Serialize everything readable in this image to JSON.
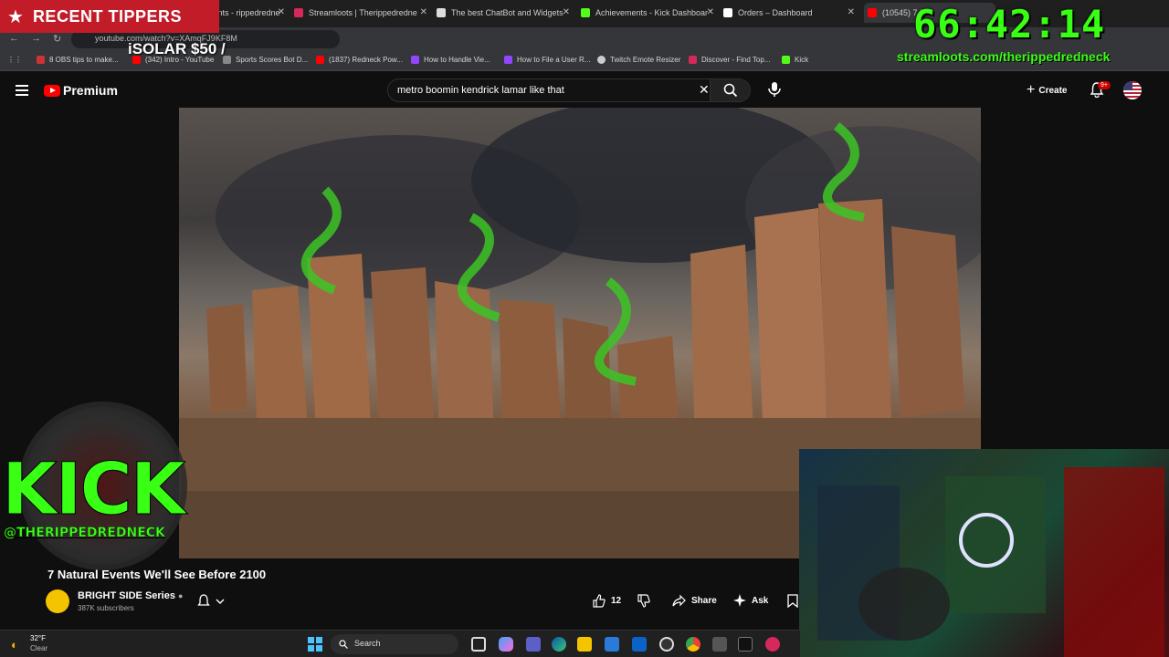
{
  "overlay": {
    "tippers_label": "RECENT TIPPERS",
    "tipper_entry": "iSOLAR $50 /",
    "timer": "66:42:14",
    "stream_url": "streamloots.com/therippedredneck",
    "kick_text": "KICK",
    "kick_handle": "@THERIPPEDREDNECK"
  },
  "browser": {
    "tabs": [
      {
        "label": "StreamElements - rippedredne",
        "color": "#333333"
      },
      {
        "label": "Streamloots | Therippedredne",
        "color": "#d6285b"
      },
      {
        "label": "The best ChatBot and Widgets",
        "color": "#dddddd"
      },
      {
        "label": "Achievements - Kick Dashboar",
        "color": "#53fc18"
      },
      {
        "label": "Orders – Dashboard",
        "color": "#ffffff"
      },
      {
        "label": "(10545) 7 R",
        "color": "#ff0000"
      }
    ],
    "url": "youtube.com/watch?v=XAmqFJ9KF8M",
    "bookmarks": [
      {
        "label": "8 OBS tips to make...",
        "color": "#cc3333"
      },
      {
        "label": "(342) Intro - YouTube",
        "color": "#ff0000"
      },
      {
        "label": "Sports Scores Bot D...",
        "color": "#888888"
      },
      {
        "label": "(1837) Redneck Pow...",
        "color": "#ff0000"
      },
      {
        "label": "How to Handle Vie...",
        "color": "#9146ff"
      },
      {
        "label": "How to File a User R...",
        "color": "#9146ff"
      },
      {
        "label": "Twitch Emote Resizer",
        "color": "#cccccc"
      },
      {
        "label": "Discover - Find Top...",
        "color": "#d6285b"
      },
      {
        "label": "Kick",
        "color": "#53fc18"
      }
    ]
  },
  "youtube": {
    "logo_text": "Premium",
    "search_query": "metro boomin kendrick lamar like that",
    "create_label": "Create",
    "notif_badge": "9+",
    "video_title": "7 Natural Events We'll See Before 2100",
    "channel_name": "BRIGHT SIDE Series",
    "subscribers": "387K subscribers",
    "likes": "12",
    "share_label": "Share",
    "ask_label": "Ask"
  },
  "taskbar": {
    "temperature": "32°F",
    "condition": "Clear",
    "search_label": "Search"
  }
}
